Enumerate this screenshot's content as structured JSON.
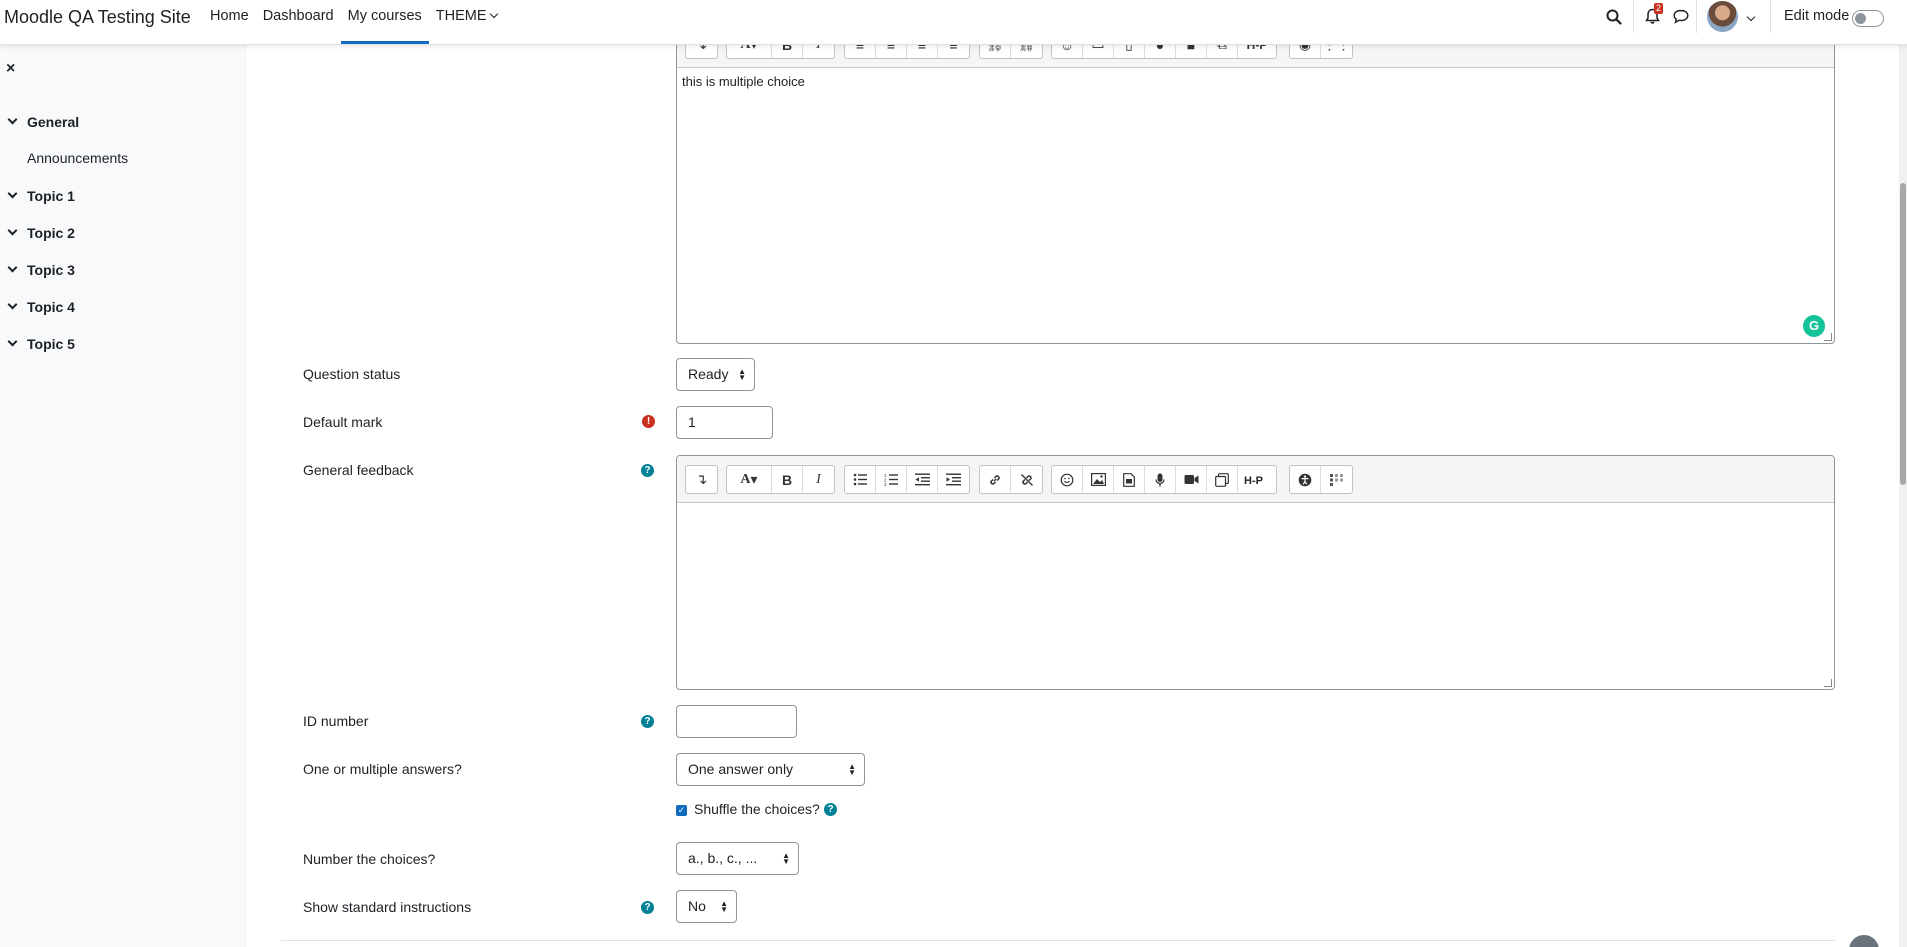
{
  "site_name": "Moodle QA Testing Site",
  "nav": {
    "home": "Home",
    "dashboard": "Dashboard",
    "my_courses": "My courses",
    "theme": "THEME"
  },
  "notifications_count": "2",
  "edit_mode_label": "Edit mode",
  "edit_mode_on": false,
  "course_index": {
    "close_icon": "×",
    "sections": [
      {
        "label": "General",
        "activities": [
          "Announcements"
        ]
      },
      {
        "label": "Topic 1"
      },
      {
        "label": "Topic 2"
      },
      {
        "label": "Topic 3"
      },
      {
        "label": "Topic 4"
      },
      {
        "label": "Topic 5"
      }
    ]
  },
  "form": {
    "question_text_content": "this is multiple choice",
    "question_status": {
      "label": "Question status",
      "value": "Ready"
    },
    "default_mark": {
      "label": "Default mark",
      "value": "1"
    },
    "general_feedback": {
      "label": "General feedback",
      "value": ""
    },
    "id_number": {
      "label": "ID number",
      "value": ""
    },
    "single": {
      "label": "One or multiple answers?",
      "value": "One answer only"
    },
    "shuffle": {
      "label": "Shuffle the choices?",
      "checked": true
    },
    "numbering": {
      "label": "Number the choices?",
      "value": "a., b., c., ..."
    },
    "show_instructions": {
      "label": "Show standard instructions",
      "value": "No"
    }
  },
  "toolbar_icons": [
    "show-more-icon",
    "font-icon",
    "bold-icon",
    "italic-icon",
    "unordered-list-icon",
    "ordered-list-icon",
    "outdent-icon",
    "indent-icon",
    "link-icon",
    "unlink-icon",
    "emoji-icon",
    "image-icon",
    "media-icon",
    "record-audio-icon",
    "record-video-icon",
    "manage-files-icon",
    "h5p-icon",
    "accessibility-checker-icon",
    "screenreader-helper-icon"
  ],
  "colors": {
    "accent": "#0f6cbf",
    "error": "#ca3120",
    "help": "#008196",
    "grammarly": "#15c39a"
  }
}
